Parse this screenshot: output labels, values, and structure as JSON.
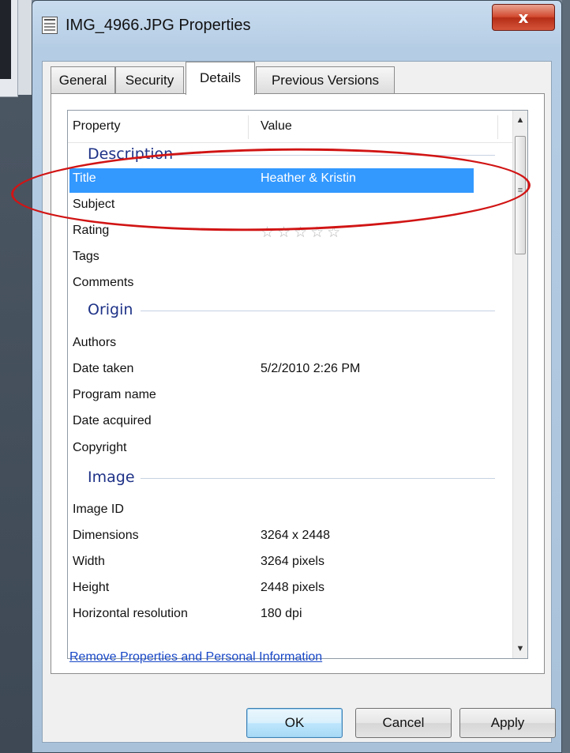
{
  "window": {
    "title": "IMG_4966.JPG Properties",
    "close_label": "x"
  },
  "tabs": [
    {
      "label": "General",
      "active": false
    },
    {
      "label": "Security",
      "active": false
    },
    {
      "label": "Details",
      "active": true
    },
    {
      "label": "Previous Versions",
      "active": false
    }
  ],
  "listview": {
    "col_property": "Property",
    "col_value": "Value",
    "groups": [
      {
        "label": "Description"
      },
      {
        "label": "Origin"
      },
      {
        "label": "Image"
      }
    ],
    "rows": [
      {
        "property": "Title",
        "value": "Heather & Kristin",
        "selected": true
      },
      {
        "property": "Subject",
        "value": ""
      },
      {
        "property": "Rating",
        "value": "",
        "rating": 0,
        "rating_max": 5
      },
      {
        "property": "Tags",
        "value": ""
      },
      {
        "property": "Comments",
        "value": ""
      },
      {
        "property": "Authors",
        "value": ""
      },
      {
        "property": "Date taken",
        "value": "5/2/2010 2:26 PM"
      },
      {
        "property": "Program name",
        "value": ""
      },
      {
        "property": "Date acquired",
        "value": ""
      },
      {
        "property": "Copyright",
        "value": ""
      },
      {
        "property": "Image ID",
        "value": ""
      },
      {
        "property": "Dimensions",
        "value": "3264 x 2448"
      },
      {
        "property": "Width",
        "value": "3264 pixels"
      },
      {
        "property": "Height",
        "value": "2448 pixels"
      },
      {
        "property": "Horizontal resolution",
        "value": "180 dpi"
      }
    ]
  },
  "stars_glyphs": "☆☆☆☆☆",
  "remove_link": "Remove Properties and Personal Information",
  "buttons": {
    "ok": "OK",
    "cancel": "Cancel",
    "apply": "Apply"
  },
  "colors": {
    "selection": "#3399ff",
    "group_label": "#1e3287",
    "annotation_ring": "#d11414"
  }
}
